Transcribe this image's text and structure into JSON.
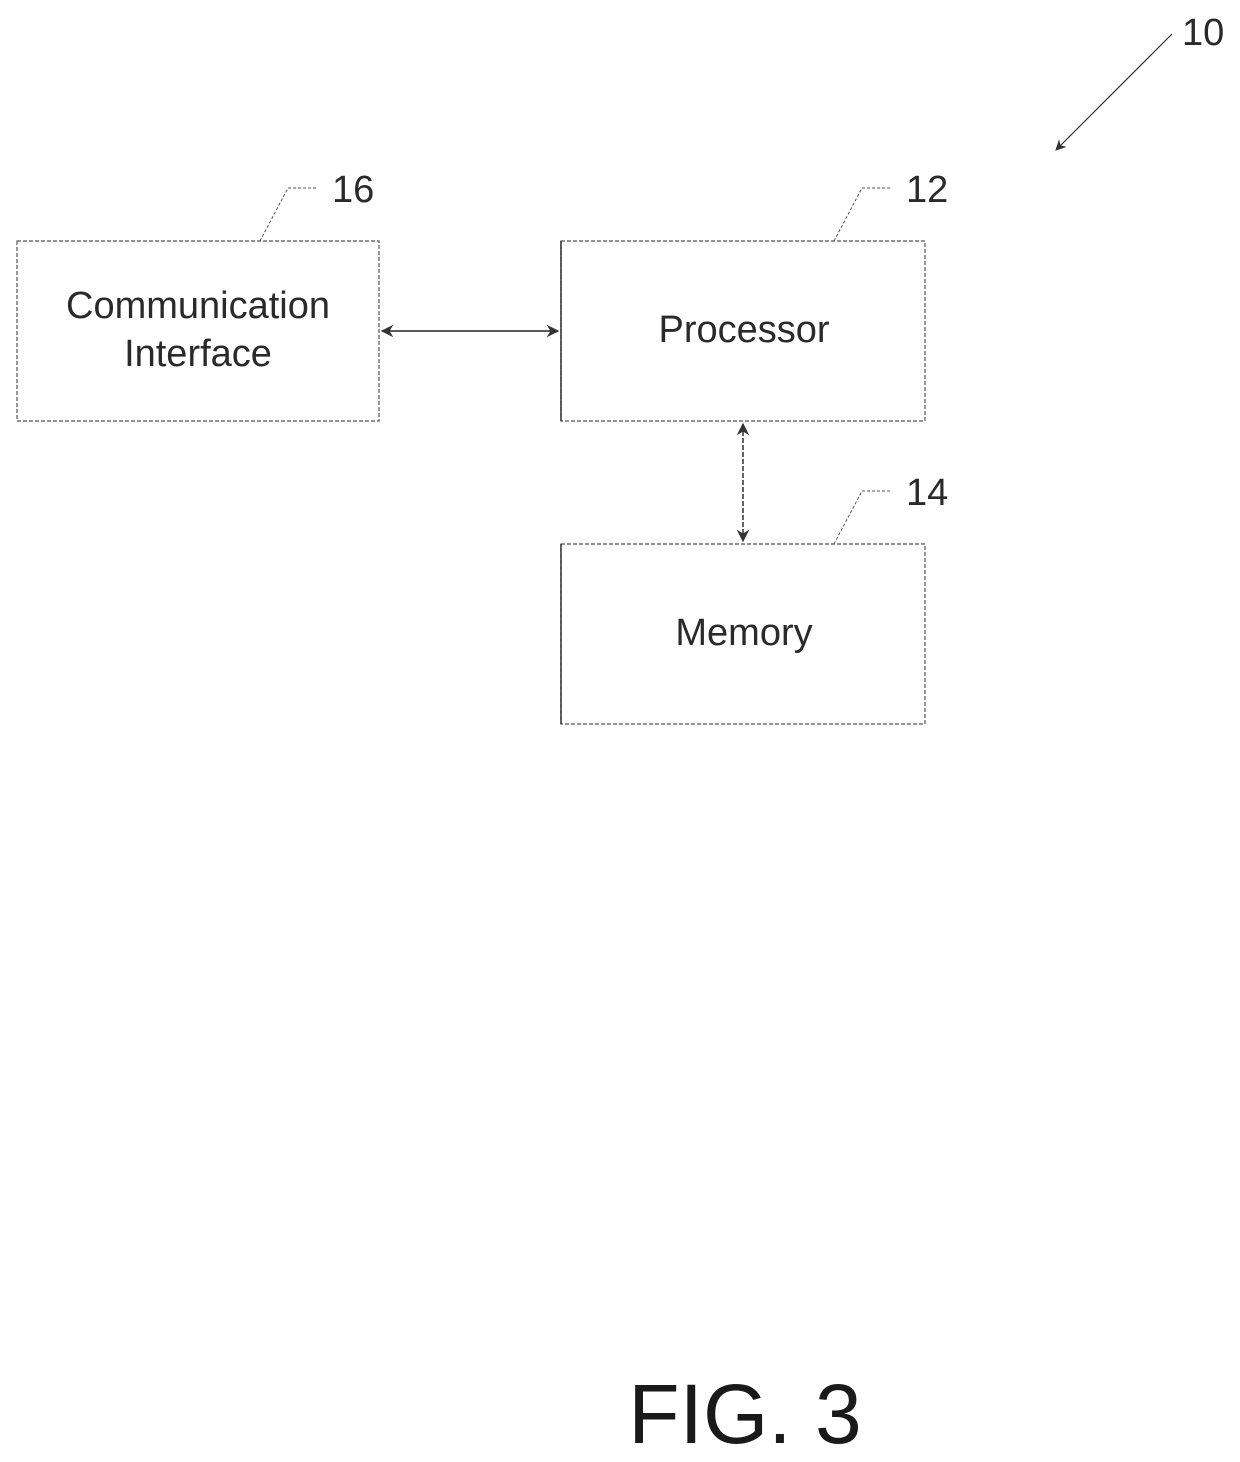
{
  "figure": {
    "label": "FIG. 3",
    "reference": "10"
  },
  "blocks": [
    {
      "id": "communication-interface",
      "ref": "16",
      "lines": [
        "Communication",
        "Interface"
      ]
    },
    {
      "id": "processor",
      "ref": "12",
      "lines": [
        "Processor"
      ]
    },
    {
      "id": "memory",
      "ref": "14",
      "lines": [
        "Memory"
      ]
    }
  ],
  "connections": [
    {
      "from": "communication-interface",
      "to": "processor",
      "direction": "bidirectional"
    },
    {
      "from": "processor",
      "to": "memory",
      "direction": "bidirectional"
    }
  ]
}
